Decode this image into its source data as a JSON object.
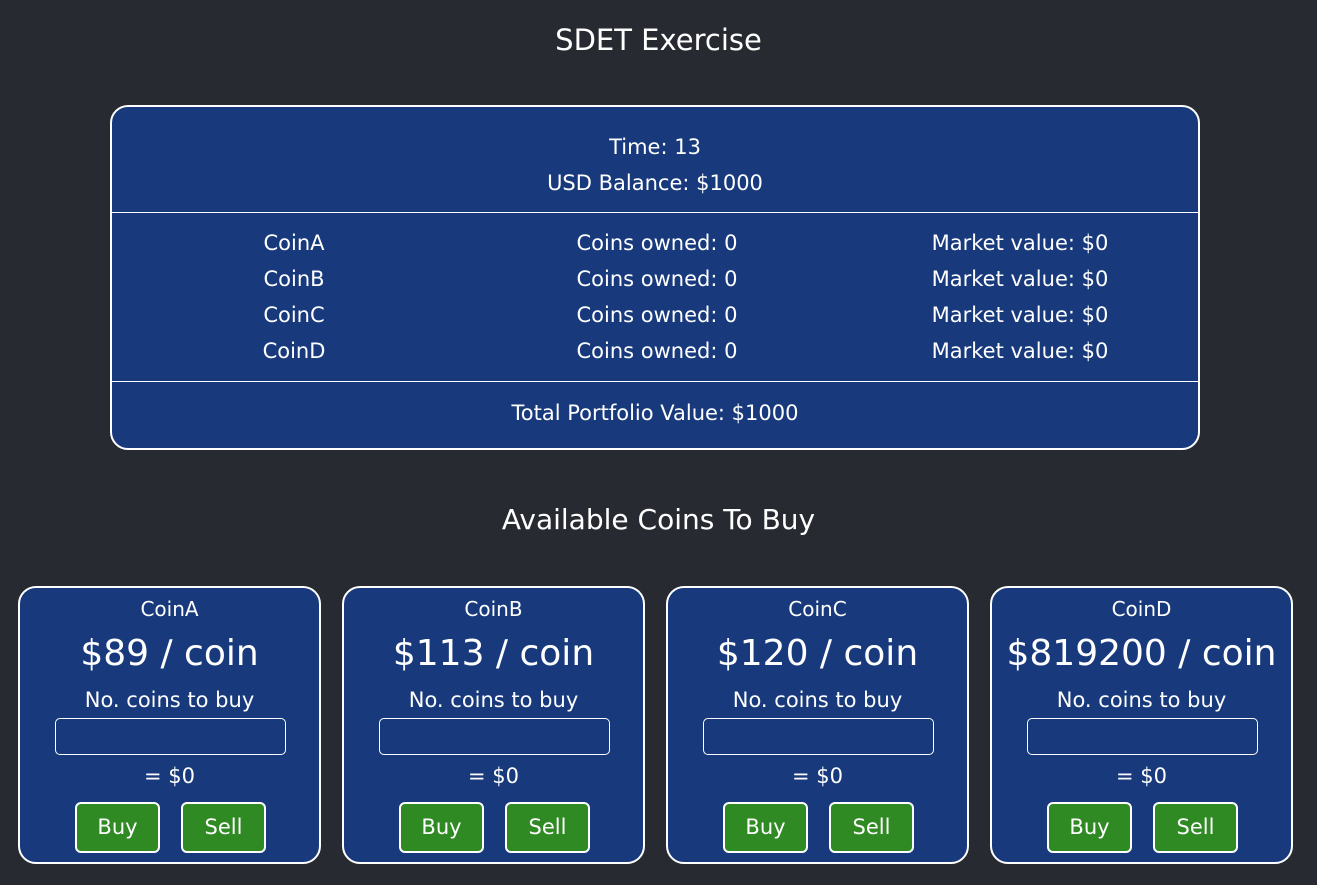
{
  "page_title": "SDET Exercise",
  "portfolio": {
    "time": "Time: 13",
    "usd_balance": "USD Balance: $1000",
    "holdings": [
      {
        "name": "CoinA",
        "owned": "Coins owned: 0",
        "market_value": "Market value: $0"
      },
      {
        "name": "CoinB",
        "owned": "Coins owned: 0",
        "market_value": "Market value: $0"
      },
      {
        "name": "CoinC",
        "owned": "Coins owned: 0",
        "market_value": "Market value: $0"
      },
      {
        "name": "CoinD",
        "owned": "Coins owned: 0",
        "market_value": "Market value: $0"
      }
    ],
    "total": "Total Portfolio Value: $1000"
  },
  "available_title": "Available Coins To Buy",
  "coins": [
    {
      "name": "CoinA",
      "price": "$89 / coin",
      "prompt": "No. coins to buy",
      "quantity": "",
      "total": "= $0",
      "buy_label": "Buy",
      "sell_label": "Sell"
    },
    {
      "name": "CoinB",
      "price": "$113 / coin",
      "prompt": "No. coins to buy",
      "quantity": "",
      "total": "= $0",
      "buy_label": "Buy",
      "sell_label": "Sell"
    },
    {
      "name": "CoinC",
      "price": "$120 / coin",
      "prompt": "No. coins to buy",
      "quantity": "",
      "total": "= $0",
      "buy_label": "Buy",
      "sell_label": "Sell"
    },
    {
      "name": "CoinD",
      "price": "$819200 / coin",
      "prompt": "No. coins to buy",
      "quantity": "",
      "total": "= $0",
      "buy_label": "Buy",
      "sell_label": "Sell"
    }
  ],
  "colors": {
    "background": "#272a30",
    "panel": "#183a7c",
    "button": "#2f8a23",
    "border": "#ffffff"
  }
}
